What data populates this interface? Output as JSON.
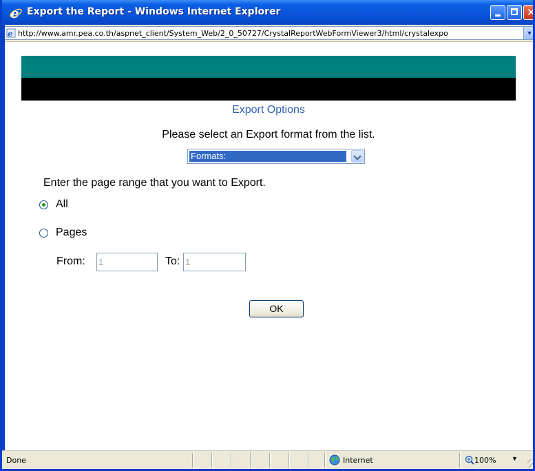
{
  "window": {
    "title": "Export the Report - Windows Internet Explorer",
    "address_url": "http://www.amr.pea.co.th/aspnet_client/System_Web/2_0_50727/CrystalReportWebFormViewer3/html/crystalexpo"
  },
  "dialog": {
    "title": "Export Options",
    "instruction": "Please select an Export format from the list.",
    "format_select_value": "Formats:",
    "range_label": "Enter the page range that you want to Export.",
    "radio_all_label": "All",
    "radio_pages_label": "Pages",
    "radio_selected": "All",
    "from_label": "From:",
    "from_value": "1",
    "to_label": "To:",
    "to_value": "1",
    "ok_label": "OK",
    "banner_colors": [
      "#007F7F",
      "#000000"
    ]
  },
  "statusbar": {
    "status_text": "Done",
    "zone_text": "Internet",
    "zoom_text": "100%"
  },
  "icons": [
    "ie-logo-icon",
    "minimize-icon",
    "maximize-icon",
    "close-icon",
    "page-icon",
    "chevron-down-icon",
    "globe-icon",
    "zoom-icon"
  ]
}
